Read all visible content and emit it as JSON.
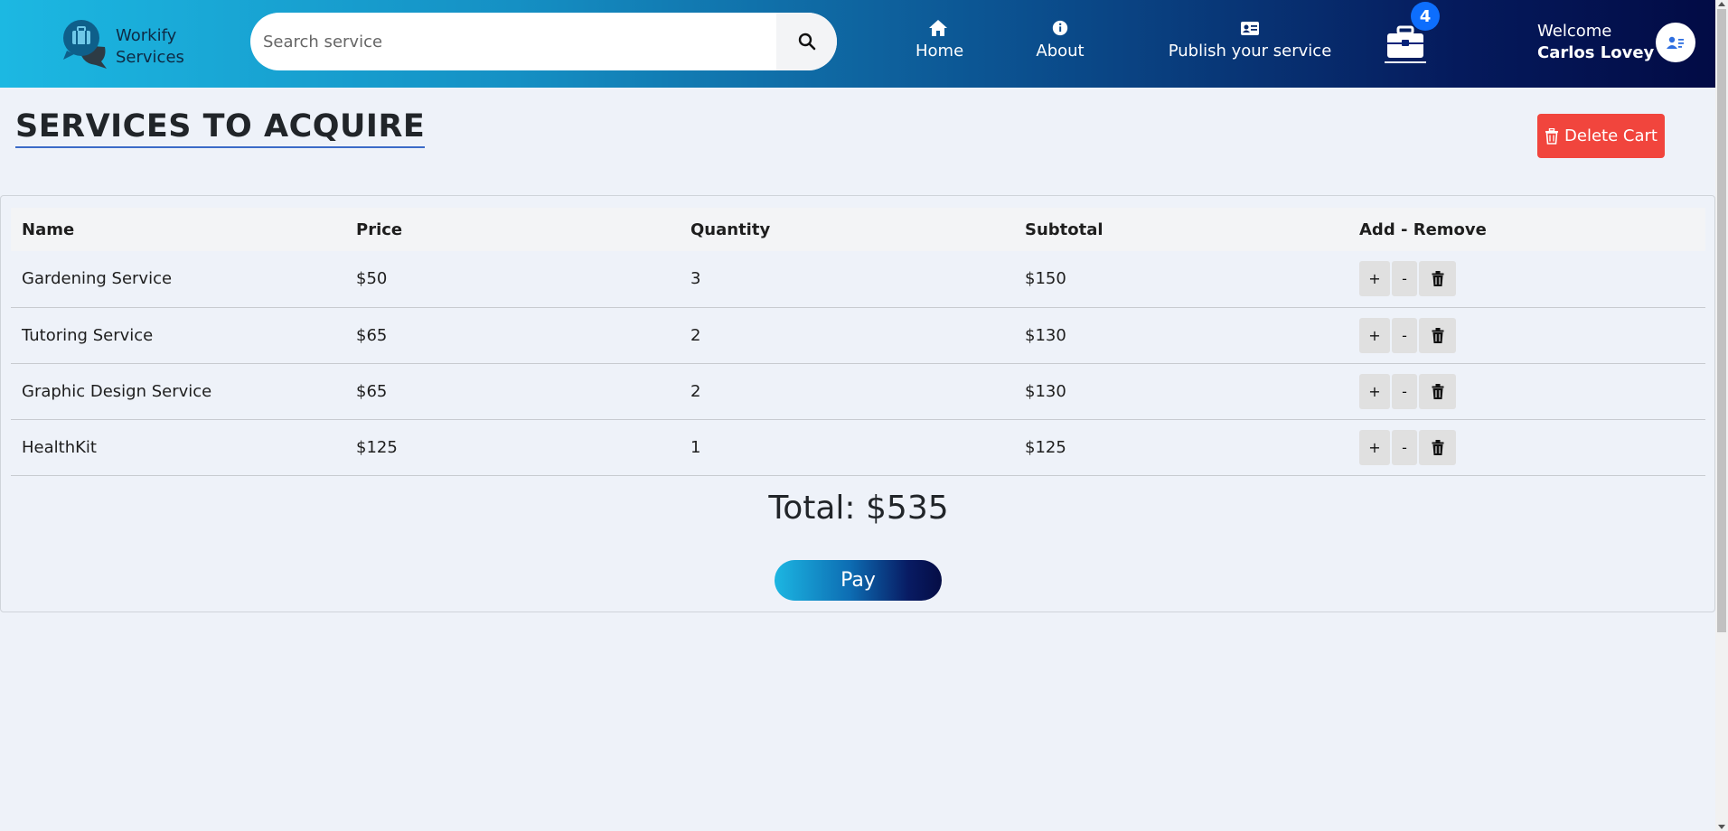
{
  "brand": {
    "line1": "Workify",
    "line2": "Services",
    "colors": {
      "accent": "#1cb8e2",
      "dark": "#020b45",
      "danger": "#f1453d"
    }
  },
  "search": {
    "placeholder": "Search service",
    "value": ""
  },
  "nav": {
    "home": {
      "label": "Home",
      "icon": "home-icon"
    },
    "about": {
      "label": "About",
      "icon": "info-icon"
    },
    "publish": {
      "label": "Publish your service",
      "icon": "id-card-icon"
    },
    "cart": {
      "icon": "briefcase-icon",
      "count": "4"
    }
  },
  "user": {
    "greeting": "Welcome",
    "name": "Carlos Lovey",
    "icon": "user-card-icon"
  },
  "page": {
    "title": "SERVICES TO ACQUIRE",
    "delete_label": "Delete Cart"
  },
  "cart": {
    "headers": {
      "name": "Name",
      "price": "Price",
      "quantity": "Quantity",
      "subtotal": "Subtotal",
      "actions": "Add - Remove"
    },
    "items": [
      {
        "name": "Gardening Service",
        "price": "$50",
        "quantity": "3",
        "subtotal": "$150"
      },
      {
        "name": "Tutoring Service",
        "price": "$65",
        "quantity": "2",
        "subtotal": "$130"
      },
      {
        "name": "Graphic Design Service",
        "price": "$65",
        "quantity": "2",
        "subtotal": "$130"
      },
      {
        "name": "HealthKit",
        "price": "$125",
        "quantity": "1",
        "subtotal": "$125"
      }
    ],
    "actions": {
      "plus": "+",
      "minus": "-"
    },
    "total": "Total: $535",
    "pay_label": "Pay"
  }
}
